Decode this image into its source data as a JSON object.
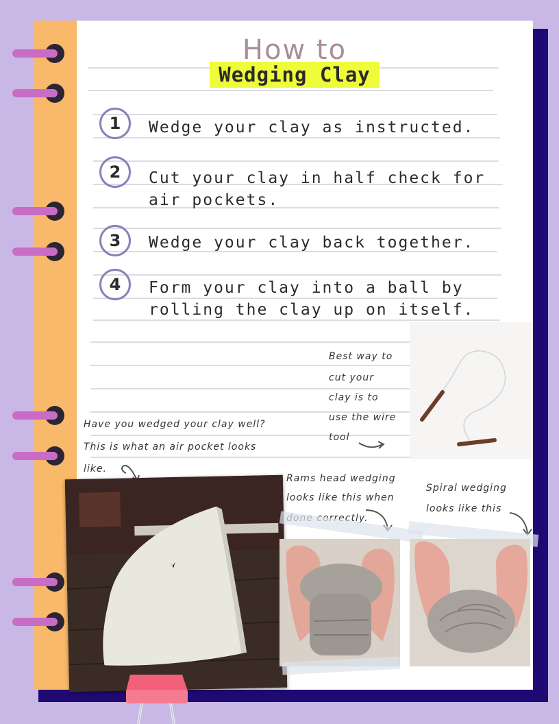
{
  "title": {
    "line1": "How to",
    "line2": "Wedging Clay"
  },
  "steps": [
    {
      "number": "1",
      "text": "Wedge your clay as instructed."
    },
    {
      "number": "2",
      "text": "Cut your clay in half check for air pockets."
    },
    {
      "number": "3",
      "text": "Wedge your clay back together."
    },
    {
      "number": "4",
      "text": "Form your clay into a ball by rolling the clay up on itself."
    }
  ],
  "notes": {
    "air_pocket": [
      "Have you wedged your clay well?",
      "This is what an air pocket looks",
      "like."
    ],
    "wire_tool": [
      "Best way to",
      "cut your",
      "clay is to",
      "use the wire",
      "tool"
    ],
    "rams_head": [
      "Rams head wedging",
      "looks like this when",
      "done correctly."
    ],
    "spiral": [
      "Spiral wedging",
      "looks like this"
    ]
  },
  "colors": {
    "background": "#c9b8e6",
    "spine": "#f9b96a",
    "highlight": "#eefc3a",
    "number_circle": "#8c7fb8",
    "rings": "#c86cc6",
    "binder_clip": "#f2607a",
    "back_page": "#1f0a73"
  }
}
